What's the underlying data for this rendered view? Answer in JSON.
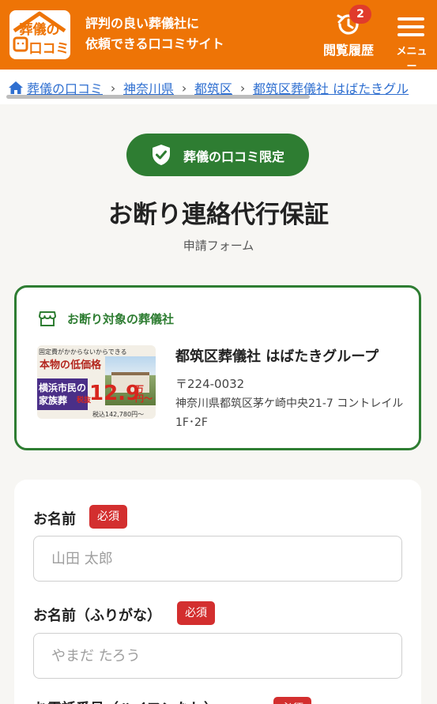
{
  "header": {
    "logo_text_top": "葬儀の",
    "logo_text_bottom": "口コミ",
    "tagline_line1": "評判の良い葬儀社に",
    "tagline_line2": "依頼できる口コミサイト",
    "history_label": "閲覧履歴",
    "history_count": "2",
    "menu_label": "メニュー",
    "brand_color": "#ee7406"
  },
  "breadcrumb": {
    "items": [
      {
        "label": "葬儀の口コミ"
      },
      {
        "label": "神奈川県"
      },
      {
        "label": "都筑区"
      },
      {
        "label": "都筑区葬儀社 はばたきグル"
      }
    ]
  },
  "badge": {
    "label": "葬儀の口コミ限定",
    "color": "#2e7d32"
  },
  "page": {
    "title": "お断り連絡代行保証",
    "subtitle": "申請フォーム"
  },
  "target": {
    "heading": "お断り対象の葬儀社",
    "name": "都筑区葬儀社 はばたきグループ",
    "zip": "〒224-0032",
    "address": "神奈川県都筑区茅ケ崎中央21-7 コントレイル1F･2F",
    "thumbnail": {
      "top_text": "固定費がかからないからできる",
      "headline": "本物の低価格",
      "sub_line1": "横浜市民の",
      "sub_line2": "家族葬",
      "tax_label": "税抜",
      "price": "12.9",
      "unit_top": "万",
      "unit_bottom": "円～",
      "footnote": "税込142,780円～"
    }
  },
  "form": {
    "fields": [
      {
        "label": "お名前",
        "required": "必須",
        "placeholder": "山田 太郎"
      },
      {
        "label": "お名前（ふりがな）",
        "required": "必須",
        "placeholder": "やまだ たろう"
      },
      {
        "label": "お電話番号（ハイフンなし）",
        "required": "必須"
      }
    ]
  }
}
